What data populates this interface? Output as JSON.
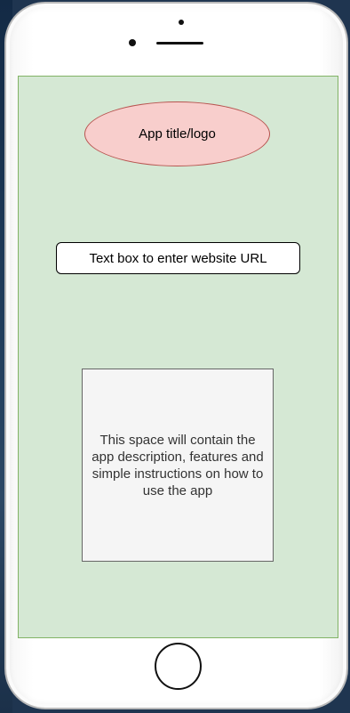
{
  "logo": {
    "label": "App title/logo"
  },
  "url_input": {
    "label": "Text box to enter website URL"
  },
  "description": {
    "text": "This space will contain the app description, features and simple instructions on how to use the app"
  },
  "colors": {
    "screen_fill": "#d5e8d4",
    "screen_border": "#82b366",
    "logo_fill": "#f8cecc",
    "logo_border": "#b85450",
    "description_fill": "#f5f5f5",
    "description_border": "#666666"
  }
}
